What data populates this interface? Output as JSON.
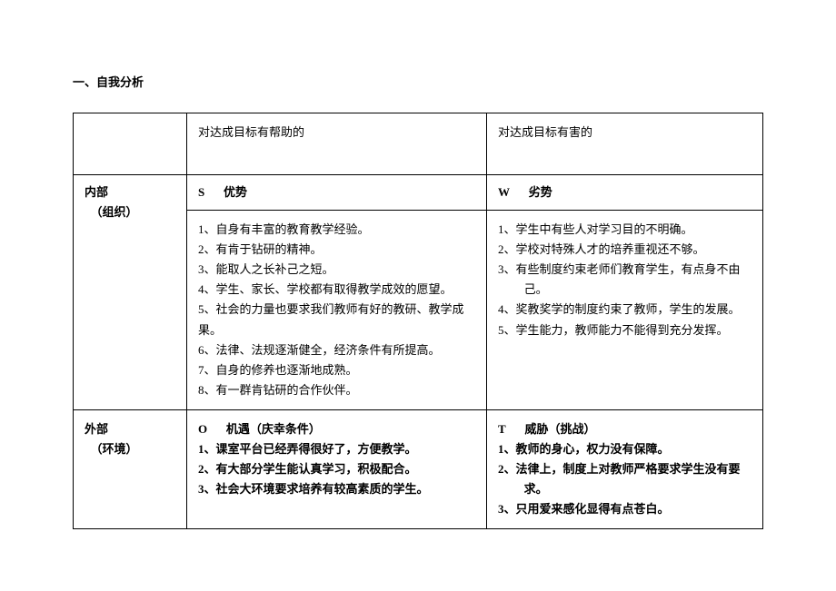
{
  "title": "一、自我分析",
  "header": {
    "helpful": "对达成目标有帮助的",
    "harmful": "对达成目标有害的"
  },
  "rows": {
    "internal": {
      "label_main": "内部",
      "label_sub": "（组织）",
      "s_letter": "S",
      "s_title": "优势",
      "w_letter": "W",
      "w_title": "劣势",
      "s_items": [
        "1、自身有丰富的教育教学经验。",
        "2、有肯于钻研的精神。",
        "3、能取人之长补己之短。",
        "4、学生、家长、学校都有取得教学成效的愿望。",
        "5、社会的力量也要求我们教师有好的教研、教学成果。",
        "6、法律、法规逐渐健全，经济条件有所提高。",
        "7、自身的修养也逐渐地成熟。",
        "8、有一群肯钻研的合作伙伴。"
      ],
      "w_items": [
        "1、学生中有些人对学习目的不明确。",
        "2、学校对特殊人才的培养重视还不够。",
        "3、有些制度约束老师们教育学生，有点身不由",
        "己。",
        "4、奖教奖学的制度约束了教师，学生的发展。",
        "5、学生能力，教师能力不能得到充分发挥。"
      ]
    },
    "external": {
      "label_main": "外部",
      "label_sub": "（环境）",
      "o_letter": "O",
      "o_title": "机遇（庆幸条件）",
      "t_letter": "T",
      "t_title": "威胁（挑战）",
      "o_items": [
        "1、课室平台已经弄得很好了，方便教学。",
        "2、有大部分学生能认真学习，积极配合。",
        "3、社会大环境要求培养有较高素质的学生。"
      ],
      "t_items": [
        "1、教师的身心，权力没有保障。",
        "2、法律上，制度上对教师严格要求学生没有要",
        "求。",
        "3、只用爱来感化显得有点苍白。"
      ]
    }
  }
}
